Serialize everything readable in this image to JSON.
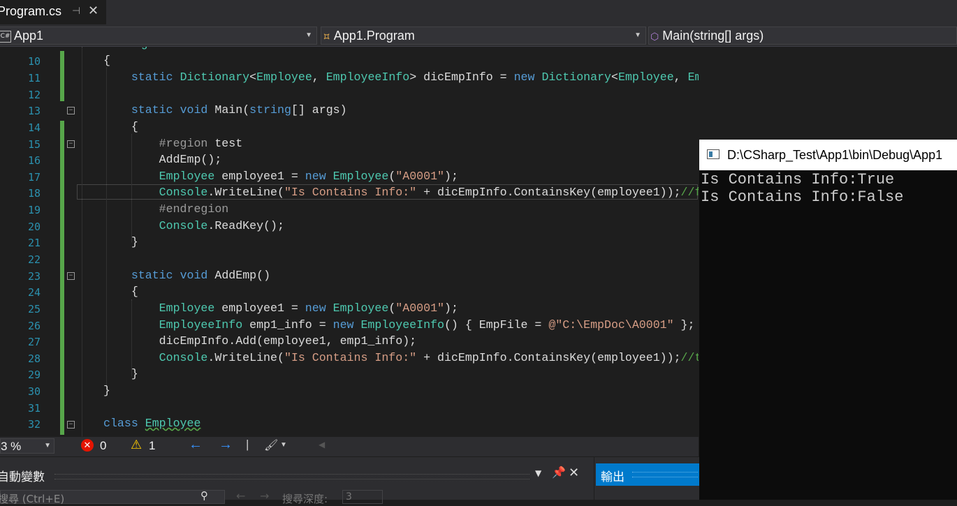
{
  "tab": {
    "title": "Program.cs",
    "pin": "⊣",
    "close": "✕"
  },
  "nav": {
    "project": "App1",
    "project_icon": "C#",
    "class": "App1.Program",
    "member": "Main(string[] args)"
  },
  "editor": {
    "partial_line": "    class Program",
    "lines": [
      {
        "n": "10"
      },
      {
        "n": "11"
      },
      {
        "n": "12"
      },
      {
        "n": "13"
      },
      {
        "n": "14"
      },
      {
        "n": "15"
      },
      {
        "n": "16"
      },
      {
        "n": "17"
      },
      {
        "n": "18"
      },
      {
        "n": "19"
      },
      {
        "n": "20"
      },
      {
        "n": "21"
      },
      {
        "n": "22"
      },
      {
        "n": "23"
      },
      {
        "n": "24"
      },
      {
        "n": "25"
      },
      {
        "n": "26"
      },
      {
        "n": "27"
      },
      {
        "n": "28"
      },
      {
        "n": "29"
      },
      {
        "n": "30"
      },
      {
        "n": "31"
      },
      {
        "n": "32"
      }
    ]
  },
  "status": {
    "zoom": "3 %",
    "errors": "0",
    "warnings": "1"
  },
  "bottom": {
    "autos_title": "自動變數",
    "search_placeholder": "搜尋 (Ctrl+E)",
    "search_depth": "搜尋深度:",
    "search_depth_value": "3",
    "output_title": "輸出"
  },
  "console": {
    "title": "D:\\CSharp_Test\\App1\\bin\\Debug\\App1",
    "lines": [
      "Is Contains Info:True",
      "Is Contains Info:False"
    ]
  },
  "colors": {
    "keyword": "#569cd6",
    "type": "#4ec9b0",
    "string": "#d69d85",
    "comment": "#57a64a",
    "line_number": "#2b91af",
    "background": "#1e1e1e"
  }
}
